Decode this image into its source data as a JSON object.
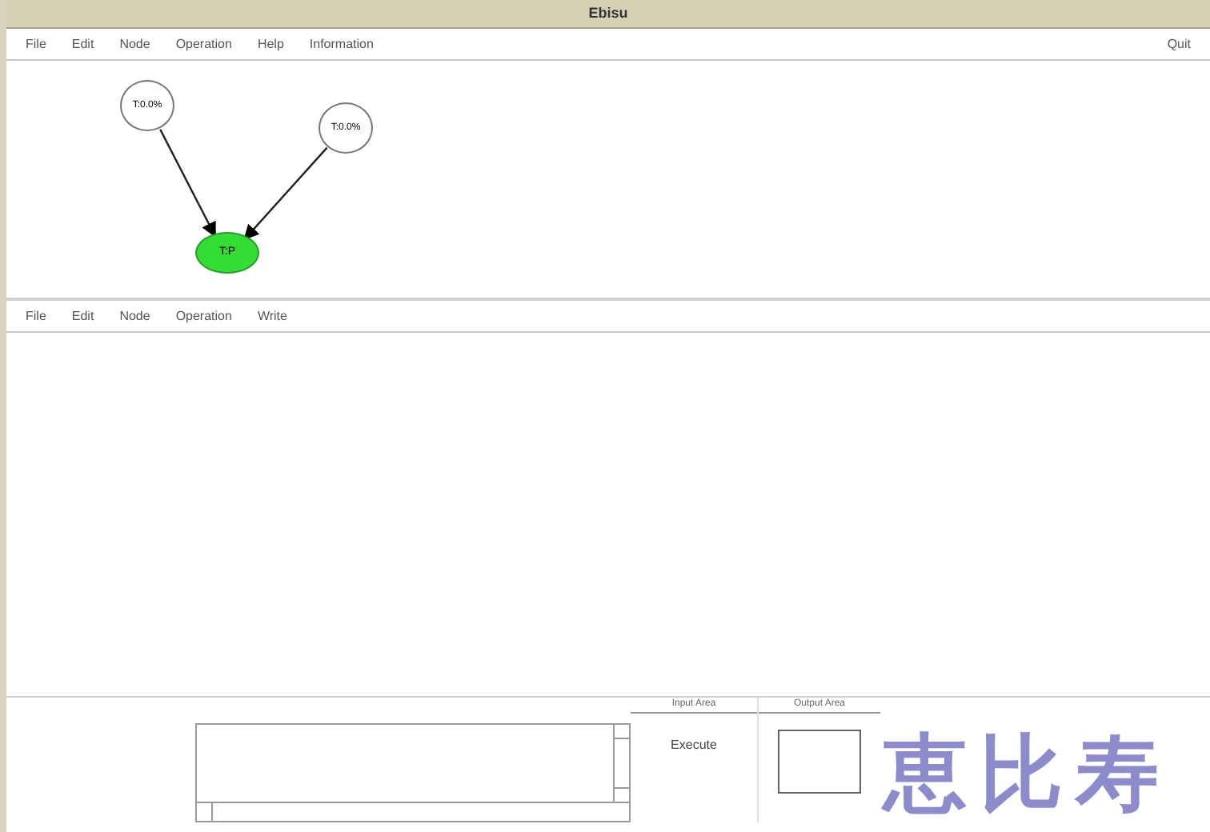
{
  "window": {
    "title": "Ebisu"
  },
  "top_menu": {
    "items": [
      "File",
      "Edit",
      "Node",
      "Operation",
      "Help",
      "Information"
    ],
    "right": "Quit"
  },
  "graph": {
    "nodes": [
      {
        "label": "T:0.0%",
        "kind": "plain"
      },
      {
        "label": "T:0.0%",
        "kind": "plain"
      },
      {
        "label": "T:P",
        "kind": "active"
      }
    ]
  },
  "lower_menu": {
    "items": [
      "File",
      "Edit",
      "Node",
      "Operation",
      "Write"
    ]
  },
  "bottom": {
    "exec_header": "Input Area",
    "exec_button": "Execute",
    "output_header": "Output Area",
    "logo": "恵比寿"
  }
}
